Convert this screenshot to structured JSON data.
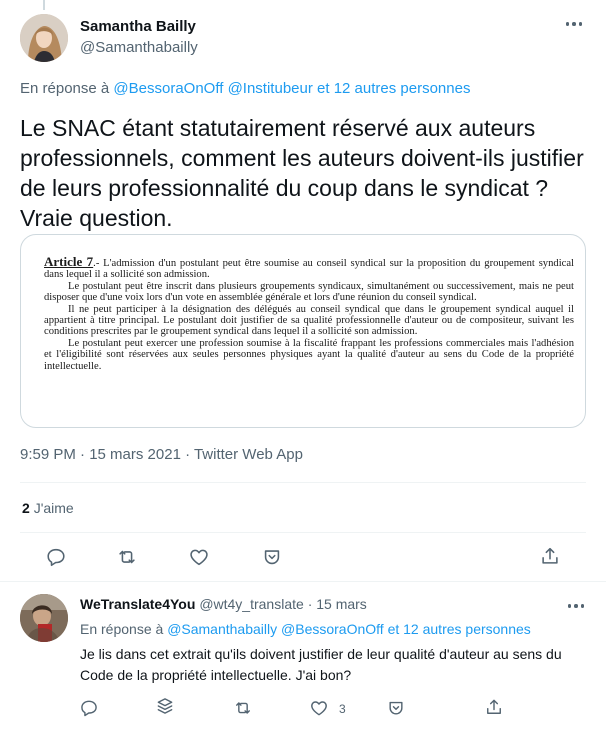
{
  "main_tweet": {
    "author_name": "Samantha Bailly",
    "author_handle": "@Samanthabailly",
    "reply_prefix": "En réponse à",
    "reply_mentions": "@BessoraOnOff @Institubeur",
    "reply_others": "et 12 autres personnes",
    "text": "Le SNAC étant statutairement réservé aux auteurs professionnels, comment les auteurs doivent-ils justifier de leurs professionnalité du coup dans le syndicat ? Vraie question.",
    "image_document": {
      "article_label": "Article 7",
      "article_intro": ".- L'admission d'un postulant peut être soumise au conseil syndical sur la proposition du groupement syndical dans lequel il a sollicité son admission.",
      "paragraph_2": "Le postulant peut être inscrit dans plusieurs groupements syndicaux, simultanément ou successivement, mais ne peut disposer que d'une voix lors d'un vote en assemblée générale et lors d'une réunion du conseil syndical.",
      "paragraph_3": "Il ne peut participer à la désignation des délégués au conseil syndical que dans le groupement syndical auquel il appartient à titre principal. Le postulant doit justifier de sa qualité professionnelle d'auteur ou de compositeur, suivant les conditions prescrites par le groupement syndical dans lequel il a sollicité son admission.",
      "paragraph_4": "Le postulant peut exercer une profession soumise à la fiscalité frappant les professions commerciales mais l'adhésion et l'éligibilité sont réservées aux seules personnes physiques ayant la qualité d'auteur au sens du Code de la propriété intellectuelle."
    },
    "timestamp": "9:59 PM · 15 mars 2021 · Twitter Web App",
    "like_count": "2",
    "like_label": "J'aime",
    "actions": [
      "reply-icon",
      "retweet-icon",
      "like-icon",
      "save-icon",
      "share-icon"
    ]
  },
  "reply_tweet": {
    "author_name": "WeTranslate4You",
    "author_handle": "@wt4y_translate",
    "date": "· 15 mars",
    "reply_prefix": "En réponse à",
    "reply_mentions": "@Samanthabailly @BessoraOnOff",
    "reply_others": "et 12 autres personnes",
    "text": "Je lis dans cet extrait qu'ils doivent justifier de leur qualité d'auteur au sens du Code de la propriété intellectuelle. J'ai bon?",
    "like_count": "3",
    "actions": [
      "reply-icon",
      "stack-icon",
      "retweet-icon",
      "like-icon",
      "save-icon",
      "share-icon"
    ]
  },
  "colors": {
    "link": "#1d9bf0",
    "secondary_text": "#536471",
    "primary_text": "#0f1419",
    "divider": "#eff3f4"
  }
}
